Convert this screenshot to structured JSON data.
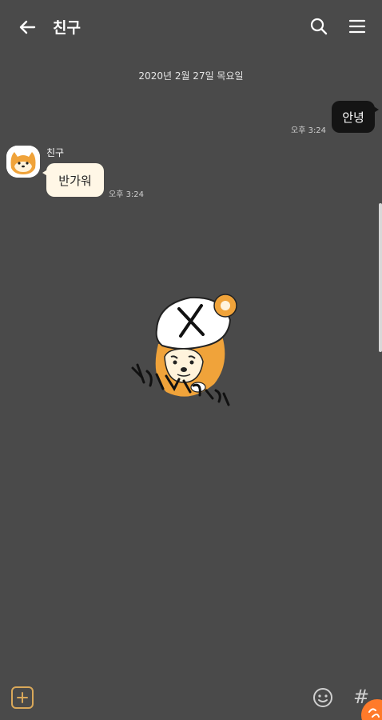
{
  "header": {
    "title": "친구",
    "icons": {
      "back": "back-arrow-icon",
      "search": "search-icon",
      "menu": "menu-icon"
    }
  },
  "chat": {
    "date_separator": "2020년 2월 27일 목요일",
    "messages": [
      {
        "sender": "me",
        "text": "안녕",
        "time": "오후 3:24"
      },
      {
        "sender": "friend",
        "name": "친구",
        "text": "반가워",
        "time": "오후 3:24"
      }
    ],
    "sticker": {
      "icon": "shiba-sticker-icon"
    }
  },
  "input_bar": {
    "icons": {
      "plus": "plus-icon",
      "emoji": "emoji-icon",
      "hash": "hash-icon",
      "float": "orange-float-icon"
    },
    "hash_glyph": "#"
  },
  "colors": {
    "background": "#4a4a4a",
    "my_bubble": "#141414",
    "friend_bubble": "#fff7e6",
    "accent": "#d9a85a",
    "float_button": "#ff7a2a"
  }
}
